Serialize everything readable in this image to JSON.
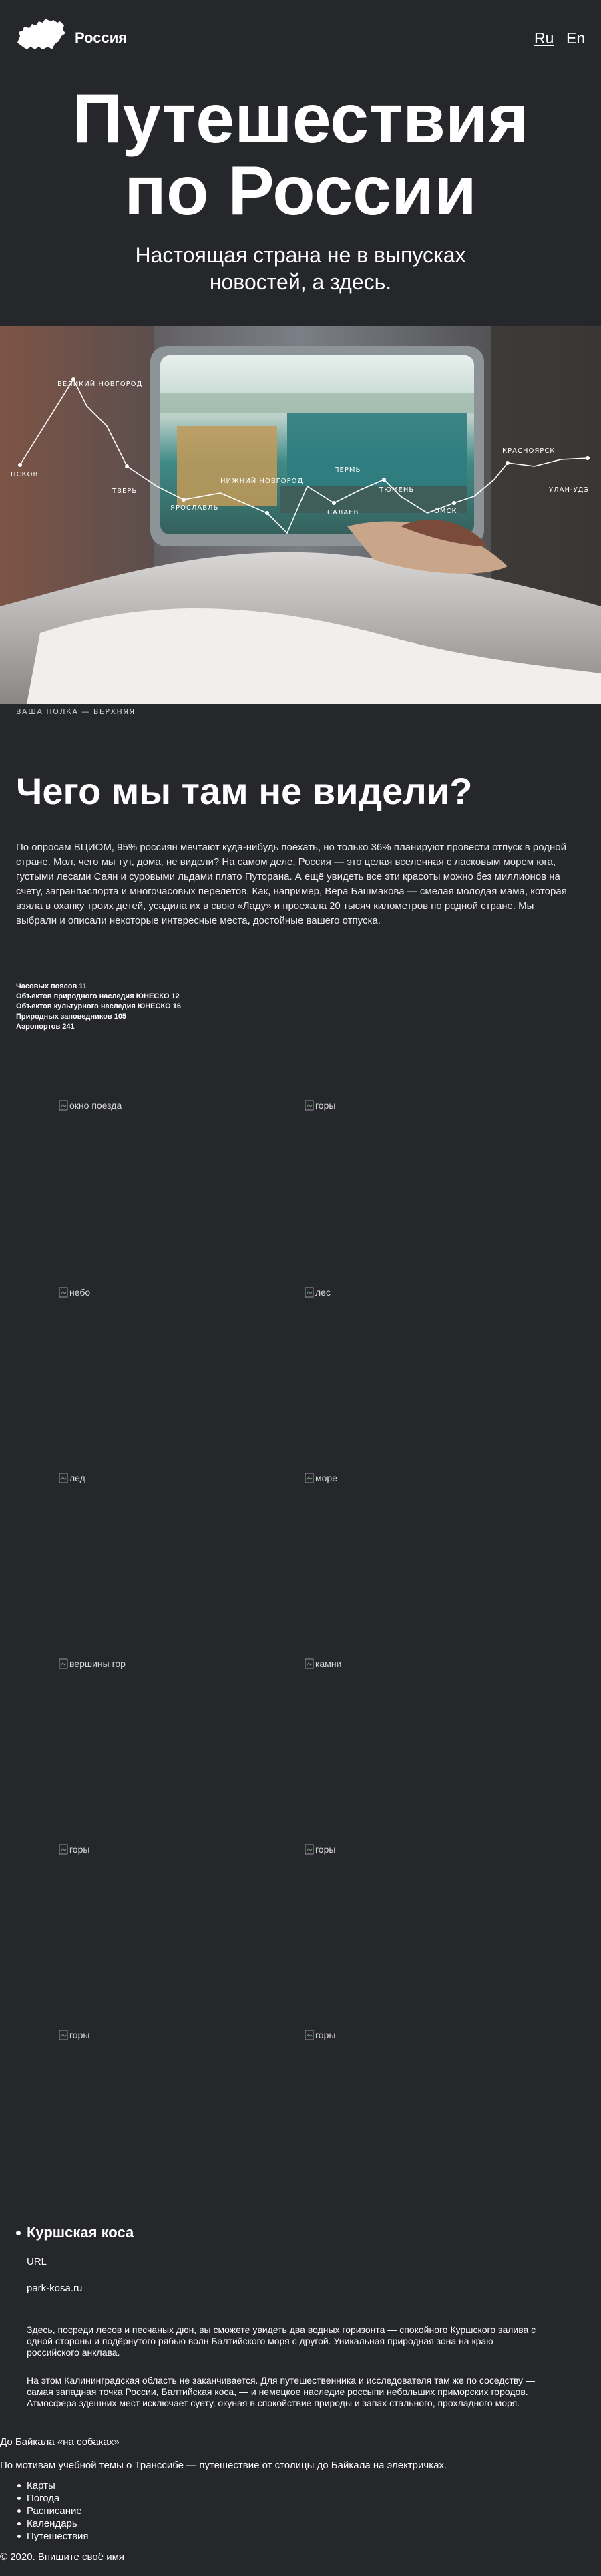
{
  "header": {
    "site_title": "Россия",
    "lang_ru": "Ru",
    "lang_en": "En"
  },
  "hero": {
    "title_line1": "Путешествия",
    "title_line2": "по России",
    "subtitle": "Настоящая страна не в выпусках новостей, а здесь."
  },
  "cover": {
    "caption": "ВАША ПОЛКА — ВЕРХНЯЯ",
    "route_labels": [
      "ПСКОВ",
      "ВЕЛИКИЙ НОВГОРОД",
      "ТВЕРЬ",
      "ЯРОСЛАВЛЬ",
      "НИЖНИЙ НОВГОРОД",
      "ПЕРМЬ",
      "САЛАЕВ",
      "ТЮМЕНЬ",
      "ОМСК",
      "КРАСНОЯРСК",
      "УЛАН-УДЭ"
    ]
  },
  "section": {
    "title": "Чего мы там не видели?",
    "intro": "По опросам ВЦИОМ, 95% россиян мечтают куда-нибудь поехать, но только 36% планируют провести отпуск в родной стране. Мол, чего мы тут, дома, не видели? На самом деле, Россия — это целая вселенная с ласковым морем юга, густыми лесами Саян и суровыми льдами плато Путорана. А ещё увидеть все эти красоты можно без миллионов на счету, загранпаспорта и многочасовых перелетов. Как, например, Вера Башмакова — смелая молодая мама, которая взяла в охапку троих детей, усадила их в свою «Ладу» и проехала 20 тысяч километров по родной стране. Мы выбрали и описали некоторые интересные места, достойные вашего отпуска."
  },
  "stats": [
    "Часовых поясов 11",
    "Объектов природного наследия ЮНЕСКО 12",
    "Объектов культурного наследия ЮНЕСКО 16",
    "Природных заповедников 105",
    "Аэропортов 241"
  ],
  "gallery": [
    "окно поезда",
    "горы",
    "небо",
    "лес",
    "лед",
    "море",
    "вершины гор",
    "камни",
    "горы",
    "горы",
    "горы",
    "горы"
  ],
  "place": {
    "title": "Куршская коса",
    "url_label": "URL",
    "url": "park-kosa.ru",
    "desc1": "Здесь, посреди лесов и песчаных дюн, вы сможете увидеть два водных горизонта — спокойного Куршского залива с одной стороны и подёрнутого рябью волн Балтийского моря с другой. Уникальная природная зона на краю российского анклава.",
    "desc2": "На этом Калининградская область не заканчивается. Для путешественника и исследователя там же по соседству — самая западная точка России, Балтийская коса, — и немецкое наследие россыпи небольших приморских городов. Атмосфера здешних мест исключает суету, окуная в спокойствие природы и запах стального, прохладного моря."
  },
  "links": {
    "baikal": "До Байкала «на собаках»",
    "project_note": "По мотивам учебной темы о Транссибе — путешествие от столицы до Байкала на электричках."
  },
  "nav": [
    "Карты",
    "Погода",
    "Расписание",
    "Календарь",
    "Путешествия"
  ],
  "footer": "© 2020. Впишите своё имя"
}
